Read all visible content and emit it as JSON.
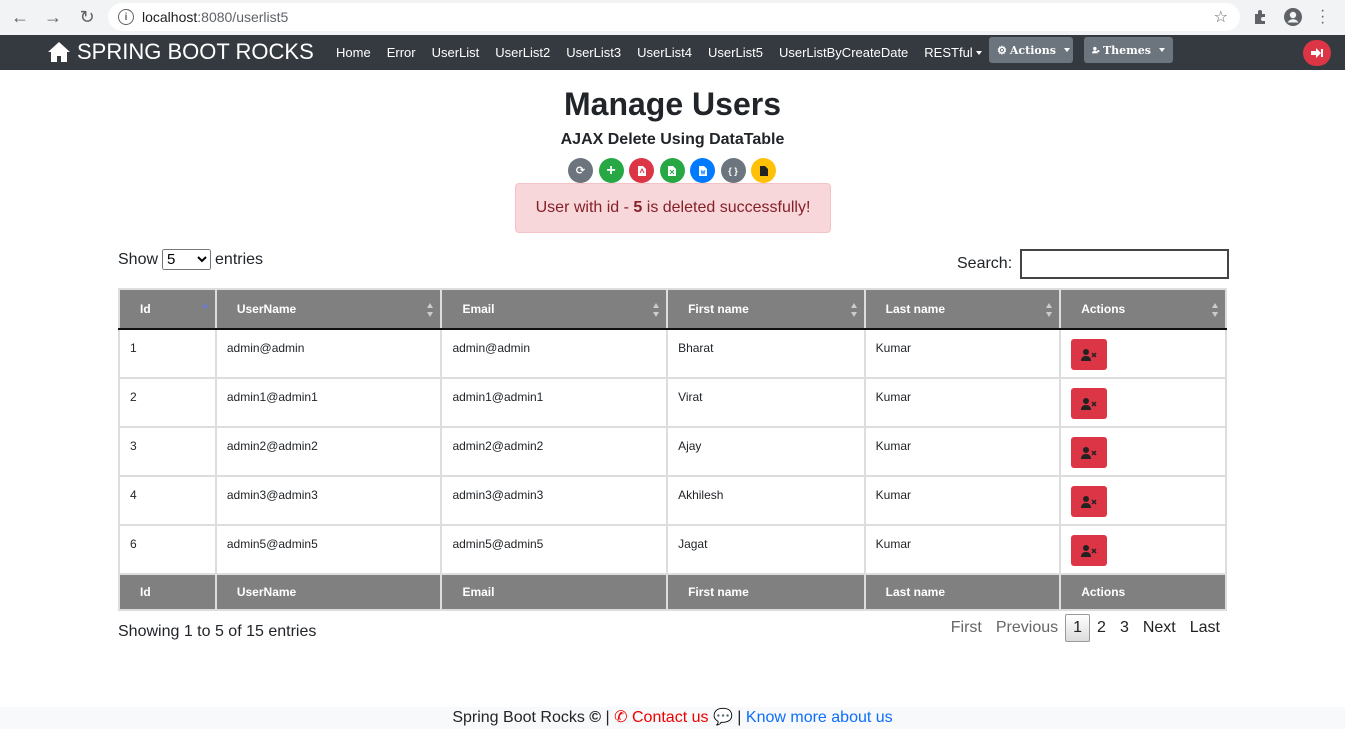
{
  "browser": {
    "url_host": "localhost",
    "url_path": ":8080/userlist5"
  },
  "nav": {
    "brand": "SPRING BOOT ROCKS",
    "links": [
      "Home",
      "Error",
      "UserList",
      "UserList2",
      "UserList3",
      "UserList4",
      "UserList5",
      "UserListByCreateDate",
      "RESTful"
    ],
    "actions_label": "Actions",
    "themes_label": "Themes"
  },
  "page": {
    "title": "Manage Users",
    "subtitle": "AJAX Delete Using DataTable",
    "alert_prefix": "User with id - ",
    "alert_id": "5",
    "alert_suffix": " is deleted successfully!"
  },
  "toolbar": [
    {
      "name": "refresh",
      "color": "#6c757d",
      "glyph": "⟳"
    },
    {
      "name": "add",
      "color": "#28a745",
      "glyph": "+"
    },
    {
      "name": "pdf",
      "color": "#dc3545",
      "glyph": "▤"
    },
    {
      "name": "excel",
      "color": "#28a745",
      "glyph": "▤"
    },
    {
      "name": "word",
      "color": "#007bff",
      "glyph": "▤"
    },
    {
      "name": "json",
      "color": "#6c757d",
      "glyph": "{ }"
    },
    {
      "name": "text",
      "color": "#ffc107",
      "glyph": "▮"
    }
  ],
  "table": {
    "show_label": "Show",
    "entries_label": "entries",
    "page_length": "5",
    "search_label": "Search:",
    "columns": [
      "Id",
      "UserName",
      "Email",
      "First name",
      "Last name",
      "Actions"
    ],
    "rows": [
      [
        "1",
        "admin@admin",
        "admin@admin",
        "Bharat",
        "Kumar"
      ],
      [
        "2",
        "admin1@admin1",
        "admin1@admin1",
        "Virat",
        "Kumar"
      ],
      [
        "3",
        "admin2@admin2",
        "admin2@admin2",
        "Ajay",
        "Kumar"
      ],
      [
        "4",
        "admin3@admin3",
        "admin3@admin3",
        "Akhilesh",
        "Kumar"
      ],
      [
        "6",
        "admin5@admin5",
        "admin5@admin5",
        "Jagat",
        "Kumar"
      ]
    ],
    "info": "Showing 1 to 5 of 15 entries",
    "pager": {
      "first": "First",
      "previous": "Previous",
      "pages": [
        "1",
        "2",
        "3"
      ],
      "current": "1",
      "next": "Next",
      "last": "Last"
    }
  },
  "footer": {
    "brand": "Spring Boot Rocks",
    "contact": "Contact us",
    "more": "Know more about us"
  }
}
